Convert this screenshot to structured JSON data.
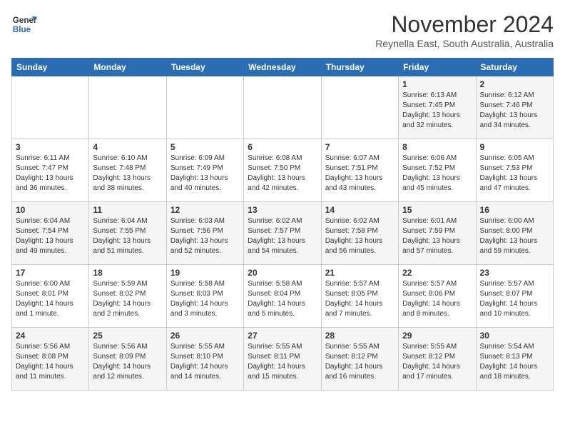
{
  "logo": {
    "line1": "General",
    "line2": "Blue"
  },
  "header": {
    "month": "November 2024",
    "location": "Reynella East, South Australia, Australia"
  },
  "weekdays": [
    "Sunday",
    "Monday",
    "Tuesday",
    "Wednesday",
    "Thursday",
    "Friday",
    "Saturday"
  ],
  "weeks": [
    [
      {
        "day": "",
        "info": ""
      },
      {
        "day": "",
        "info": ""
      },
      {
        "day": "",
        "info": ""
      },
      {
        "day": "",
        "info": ""
      },
      {
        "day": "",
        "info": ""
      },
      {
        "day": "1",
        "info": "Sunrise: 6:13 AM\nSunset: 7:45 PM\nDaylight: 13 hours\nand 32 minutes."
      },
      {
        "day": "2",
        "info": "Sunrise: 6:12 AM\nSunset: 7:46 PM\nDaylight: 13 hours\nand 34 minutes."
      }
    ],
    [
      {
        "day": "3",
        "info": "Sunrise: 6:11 AM\nSunset: 7:47 PM\nDaylight: 13 hours\nand 36 minutes."
      },
      {
        "day": "4",
        "info": "Sunrise: 6:10 AM\nSunset: 7:48 PM\nDaylight: 13 hours\nand 38 minutes."
      },
      {
        "day": "5",
        "info": "Sunrise: 6:09 AM\nSunset: 7:49 PM\nDaylight: 13 hours\nand 40 minutes."
      },
      {
        "day": "6",
        "info": "Sunrise: 6:08 AM\nSunset: 7:50 PM\nDaylight: 13 hours\nand 42 minutes."
      },
      {
        "day": "7",
        "info": "Sunrise: 6:07 AM\nSunset: 7:51 PM\nDaylight: 13 hours\nand 43 minutes."
      },
      {
        "day": "8",
        "info": "Sunrise: 6:06 AM\nSunset: 7:52 PM\nDaylight: 13 hours\nand 45 minutes."
      },
      {
        "day": "9",
        "info": "Sunrise: 6:05 AM\nSunset: 7:53 PM\nDaylight: 13 hours\nand 47 minutes."
      }
    ],
    [
      {
        "day": "10",
        "info": "Sunrise: 6:04 AM\nSunset: 7:54 PM\nDaylight: 13 hours\nand 49 minutes."
      },
      {
        "day": "11",
        "info": "Sunrise: 6:04 AM\nSunset: 7:55 PM\nDaylight: 13 hours\nand 51 minutes."
      },
      {
        "day": "12",
        "info": "Sunrise: 6:03 AM\nSunset: 7:56 PM\nDaylight: 13 hours\nand 52 minutes."
      },
      {
        "day": "13",
        "info": "Sunrise: 6:02 AM\nSunset: 7:57 PM\nDaylight: 13 hours\nand 54 minutes."
      },
      {
        "day": "14",
        "info": "Sunrise: 6:02 AM\nSunset: 7:58 PM\nDaylight: 13 hours\nand 56 minutes."
      },
      {
        "day": "15",
        "info": "Sunrise: 6:01 AM\nSunset: 7:59 PM\nDaylight: 13 hours\nand 57 minutes."
      },
      {
        "day": "16",
        "info": "Sunrise: 6:00 AM\nSunset: 8:00 PM\nDaylight: 13 hours\nand 59 minutes."
      }
    ],
    [
      {
        "day": "17",
        "info": "Sunrise: 6:00 AM\nSunset: 8:01 PM\nDaylight: 14 hours\nand 1 minute."
      },
      {
        "day": "18",
        "info": "Sunrise: 5:59 AM\nSunset: 8:02 PM\nDaylight: 14 hours\nand 2 minutes."
      },
      {
        "day": "19",
        "info": "Sunrise: 5:58 AM\nSunset: 8:03 PM\nDaylight: 14 hours\nand 3 minutes."
      },
      {
        "day": "20",
        "info": "Sunrise: 5:58 AM\nSunset: 8:04 PM\nDaylight: 14 hours\nand 5 minutes."
      },
      {
        "day": "21",
        "info": "Sunrise: 5:57 AM\nSunset: 8:05 PM\nDaylight: 14 hours\nand 7 minutes."
      },
      {
        "day": "22",
        "info": "Sunrise: 5:57 AM\nSunset: 8:06 PM\nDaylight: 14 hours\nand 8 minutes."
      },
      {
        "day": "23",
        "info": "Sunrise: 5:57 AM\nSunset: 8:07 PM\nDaylight: 14 hours\nand 10 minutes."
      }
    ],
    [
      {
        "day": "24",
        "info": "Sunrise: 5:56 AM\nSunset: 8:08 PM\nDaylight: 14 hours\nand 11 minutes."
      },
      {
        "day": "25",
        "info": "Sunrise: 5:56 AM\nSunset: 8:09 PM\nDaylight: 14 hours\nand 12 minutes."
      },
      {
        "day": "26",
        "info": "Sunrise: 5:55 AM\nSunset: 8:10 PM\nDaylight: 14 hours\nand 14 minutes."
      },
      {
        "day": "27",
        "info": "Sunrise: 5:55 AM\nSunset: 8:11 PM\nDaylight: 14 hours\nand 15 minutes."
      },
      {
        "day": "28",
        "info": "Sunrise: 5:55 AM\nSunset: 8:12 PM\nDaylight: 14 hours\nand 16 minutes."
      },
      {
        "day": "29",
        "info": "Sunrise: 5:55 AM\nSunset: 8:12 PM\nDaylight: 14 hours\nand 17 minutes."
      },
      {
        "day": "30",
        "info": "Sunrise: 5:54 AM\nSunset: 8:13 PM\nDaylight: 14 hours\nand 18 minutes."
      }
    ]
  ]
}
